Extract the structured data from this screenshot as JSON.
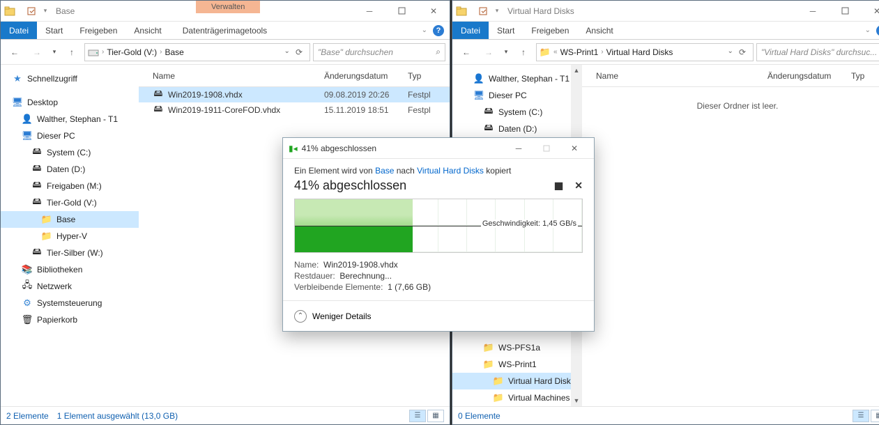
{
  "win1": {
    "title": "Base",
    "regtab": "Verwalten",
    "tabs": {
      "file": "Datei",
      "start": "Start",
      "share": "Freigeben",
      "view": "Ansicht",
      "context": "Datenträgerimagetools"
    },
    "crumbs": [
      "Tier-Gold (V:)",
      "Base"
    ],
    "search_placeholder": "\"Base\" durchsuchen",
    "columns": {
      "name": "Name",
      "date": "Änderungsdatum",
      "type": "Typ"
    },
    "rows": [
      {
        "name": "Win2019-1908.vhdx",
        "date": "09.08.2019 20:26",
        "type": "Festpl"
      },
      {
        "name": "Win2019-1911-CoreFOD.vhdx",
        "date": "15.11.2019 18:51",
        "type": "Festpl"
      }
    ],
    "status": {
      "count": "2 Elemente",
      "sel": "1 Element ausgewählt (13,0 GB)"
    },
    "nav": {
      "quick": "Schnellzugriff",
      "desktop": "Desktop",
      "user": "Walther, Stephan - T1",
      "pc": "Dieser PC",
      "c": "System (C:)",
      "d": "Daten (D:)",
      "m": "Freigaben (M:)",
      "v": "Tier-Gold (V:)",
      "base": "Base",
      "hyperv": "Hyper-V",
      "w": "Tier-Silber (W:)",
      "libs": "Bibliotheken",
      "net": "Netzwerk",
      "ctrl": "Systemsteuerung",
      "trash": "Papierkorb"
    }
  },
  "win2": {
    "title": "Virtual Hard Disks",
    "tabs": {
      "file": "Datei",
      "start": "Start",
      "share": "Freigeben",
      "view": "Ansicht"
    },
    "crumbs": [
      "WS-Print1",
      "Virtual Hard Disks"
    ],
    "search_placeholder": "\"Virtual Hard Disks\" durchsuc...",
    "columns": {
      "name": "Name",
      "date": "Änderungsdatum",
      "type": "Typ"
    },
    "empty": "Dieser Ordner ist leer.",
    "status": {
      "count": "0 Elemente"
    },
    "nav": {
      "user": "Walther, Stephan - T1",
      "pc": "Dieser PC",
      "c": "System (C:)",
      "d": "Daten (D:)",
      "pfs": "WS-PFS1a",
      "print": "WS-Print1",
      "vhd": "Virtual Hard Disks",
      "vm": "Virtual Machines"
    }
  },
  "dlg": {
    "title": "41% abgeschlossen",
    "msg_pre": "Ein Element wird von ",
    "msg_src": "Base",
    "msg_mid": " nach ",
    "msg_dst": "Virtual Hard Disks",
    "msg_post": " kopiert",
    "pct": "41% abgeschlossen",
    "speed_label": "Geschwindigkeit: ",
    "speed": "1,45 GB/s",
    "name_label": "Name:",
    "name": "Win2019-1908.vhdx",
    "rest_label": "Restdauer:",
    "rest": "Berechnung...",
    "remain_label": "Verbleibende Elemente:",
    "remain": "1 (7,66 GB)",
    "fewer": "Weniger Details"
  }
}
